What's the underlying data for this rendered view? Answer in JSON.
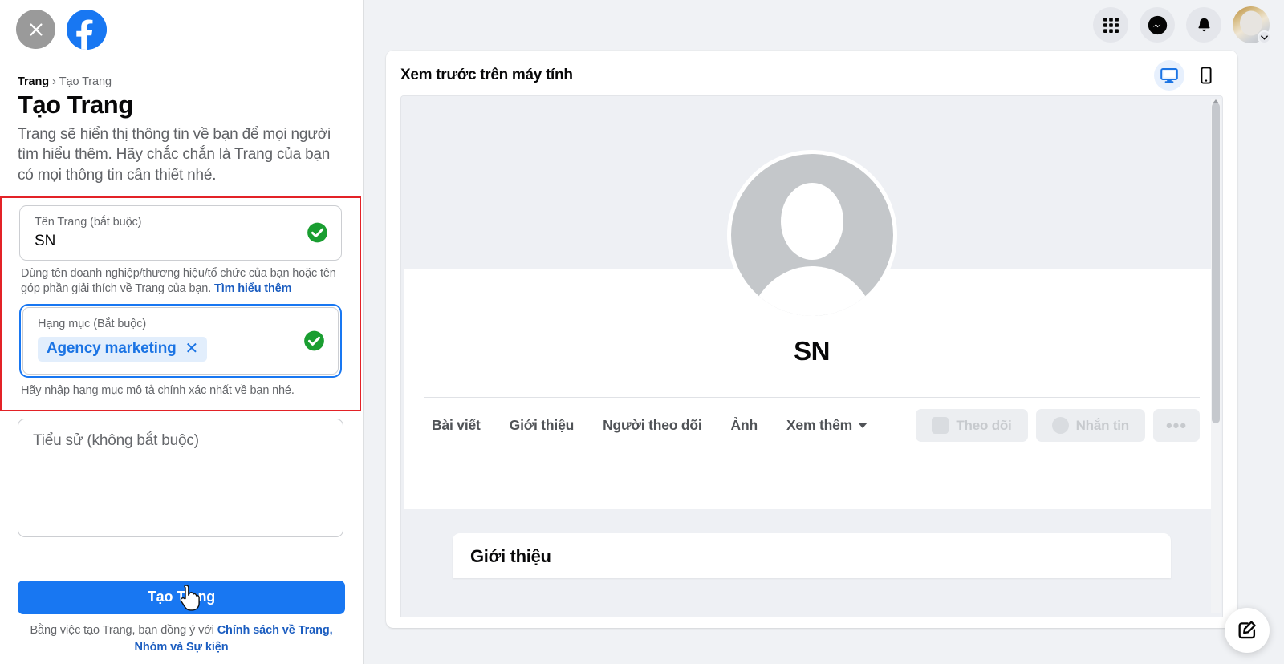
{
  "window": {
    "close_label": "×",
    "brand": "facebook"
  },
  "top_nav": {
    "items": [
      {
        "name": "menu-grid",
        "label": "Menu"
      },
      {
        "name": "messenger",
        "label": "Messenger"
      },
      {
        "name": "notifications",
        "label": "Thông báo"
      },
      {
        "name": "account",
        "label": "Tài khoản"
      }
    ]
  },
  "sidebar": {
    "breadcrumb": {
      "root": "Trang",
      "separator": "›",
      "current": "Tạo Trang"
    },
    "title": "Tạo Trang",
    "description": "Trang sẽ hiển thị thông tin về bạn để mọi người tìm hiểu thêm. Hãy chắc chắn là Trang của bạn có mọi thông tin cần thiết nhé.",
    "fields": {
      "page_name": {
        "label": "Tên Trang (bắt buộc)",
        "value": "SN",
        "valid": true,
        "helper": "Dùng tên doanh nghiệp/thương hiệu/tổ chức của bạn hoặc tên góp phần giải thích về Trang của bạn.",
        "helper_link": "Tìm hiểu thêm"
      },
      "category": {
        "label": "Hạng mục (Bắt buộc)",
        "chip": "Agency marketing",
        "chip_remove": "✕",
        "valid": true,
        "helper": "Hãy nhập hạng mục mô tả chính xác nhất về bạn nhé.",
        "focused": true
      },
      "bio": {
        "label": "Tiểu sử (không bắt buộc)",
        "value": "",
        "placeholder": "Tiểu sử (không bắt buộc)"
      }
    },
    "submit_label": "Tạo Trang",
    "terms": {
      "prefix": "Bằng việc tạo Trang, bạn đồng ý với ",
      "link": "Chính sách về Trang, Nhóm và Sự kiện"
    }
  },
  "preview": {
    "title": "Xem trước trên máy tính",
    "devices": [
      {
        "name": "desktop",
        "active": true
      },
      {
        "name": "mobile",
        "active": false
      }
    ],
    "page": {
      "name": "SN",
      "tabs": [
        {
          "label": "Bài viết"
        },
        {
          "label": "Giới thiệu"
        },
        {
          "label": "Người theo dõi"
        },
        {
          "label": "Ảnh"
        },
        {
          "label": "Xem thêm",
          "caret": true
        }
      ],
      "actions": [
        {
          "label": "Theo dõi",
          "icon": "follow-icon"
        },
        {
          "label": "Nhắn tin",
          "icon": "messenger-icon"
        },
        {
          "label": "•••",
          "icon": "more-icon"
        }
      ],
      "about_card_title": "Giới thiệu"
    }
  },
  "fab": {
    "name": "edit-fab",
    "label": "Chỉnh sửa"
  },
  "colors": {
    "brand_blue": "#1877f2",
    "link_blue": "#1b5dc0",
    "chip_blue": "#1b74e4",
    "valid_green": "#28a745",
    "highlight_red": "#e32227",
    "bg_grey": "#f0f2f5"
  }
}
